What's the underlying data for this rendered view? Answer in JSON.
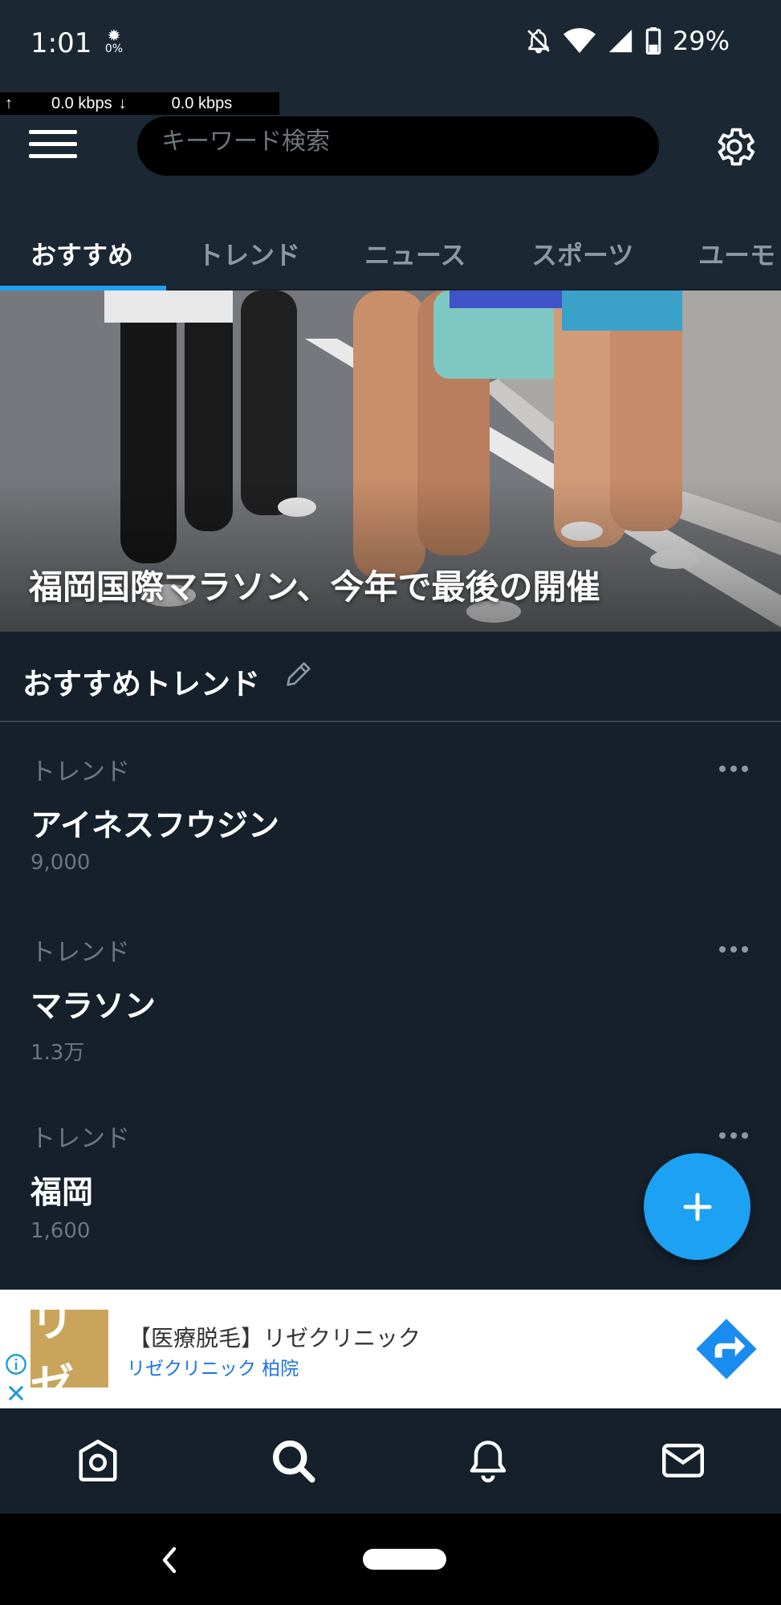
{
  "status_bar": {
    "time": "1:01",
    "data_saver_pct": "0%",
    "battery": "29%",
    "icons": [
      "silent-mode-icon",
      "wifi-icon",
      "signal-icon",
      "battery-icon"
    ]
  },
  "netspeed": {
    "up": "0.0 kbps",
    "down": "0.0 kbps"
  },
  "header": {
    "search_placeholder": "キーワード検索"
  },
  "tabs": [
    {
      "label": "おすすめ",
      "active": true
    },
    {
      "label": "トレンド",
      "active": false
    },
    {
      "label": "ニュース",
      "active": false
    },
    {
      "label": "スポーツ",
      "active": false
    },
    {
      "label": "ユーモ",
      "active": false
    }
  ],
  "hero": {
    "title": "福岡国際マラソン、今年で最後の開催"
  },
  "section": {
    "title": "おすすめトレンド"
  },
  "trends": [
    {
      "meta": "トレンド",
      "name": "アイネスフウジン",
      "count": "9,000"
    },
    {
      "meta": "トレンド",
      "name": "マラソン",
      "count": "1.3万"
    },
    {
      "meta": "トレンド",
      "name": "福岡",
      "count": "1,600"
    }
  ],
  "ad": {
    "logo_text": "リゼ",
    "title": "【医療脱毛】リゼクリニック",
    "subtitle": "リゼクリニック 柏院"
  },
  "bottom_nav": [
    "home-icon",
    "search-icon",
    "notifications-icon",
    "messages-icon"
  ],
  "colors": {
    "background": "#15202b",
    "header": "#1b2733",
    "accent": "#1da1f2",
    "muted": "#6e767d"
  }
}
